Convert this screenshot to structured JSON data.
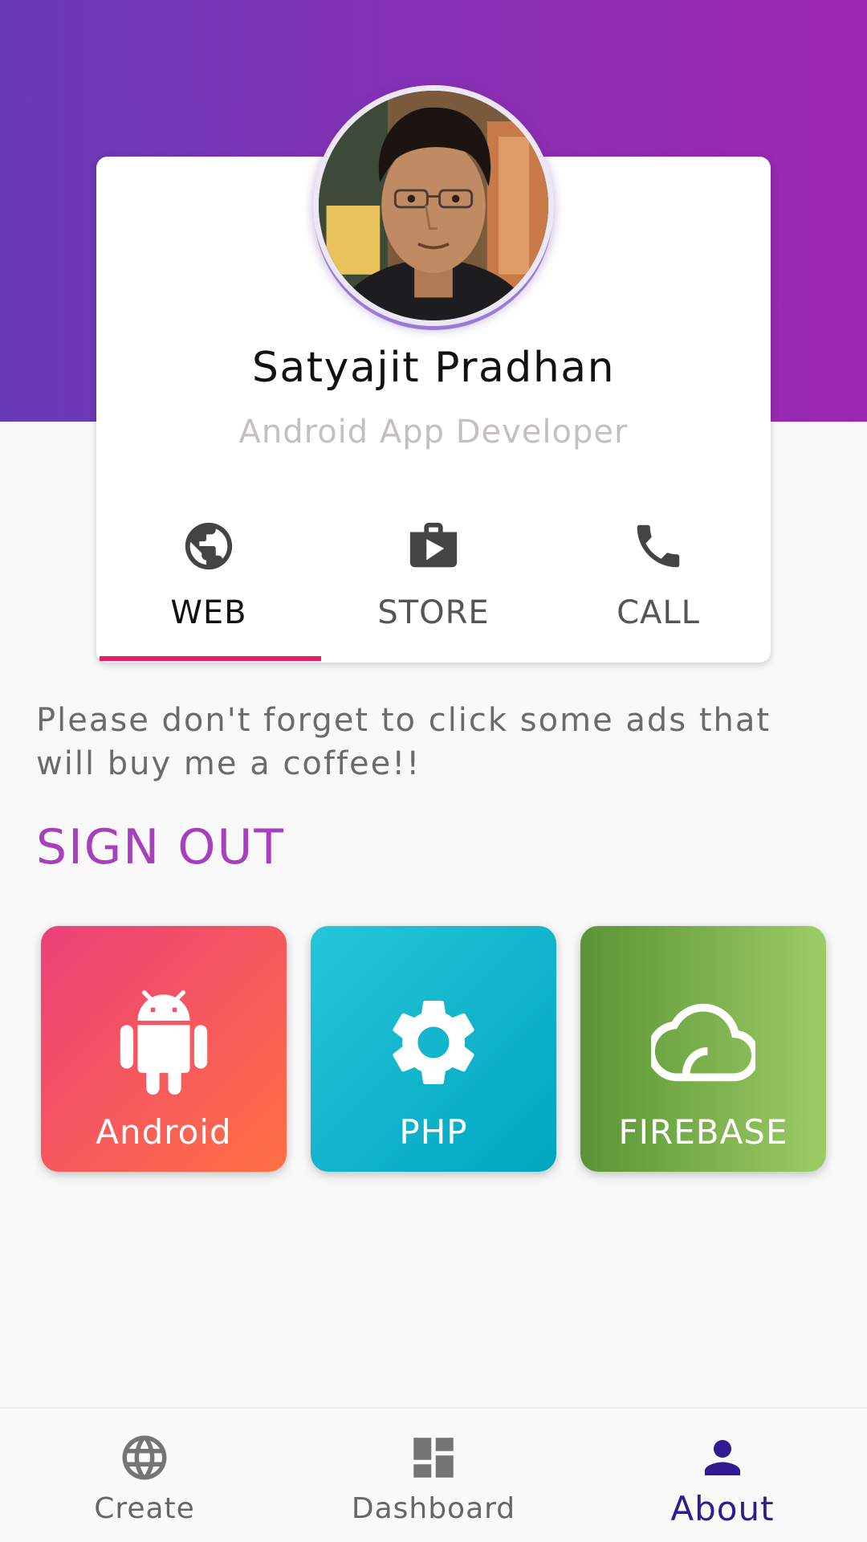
{
  "profile": {
    "name": "Satyajit Pradhan",
    "role": "Android App Developer",
    "avatar": "profile-photo"
  },
  "tabs": [
    {
      "label": "WEB",
      "icon": "globe-icon",
      "active": true
    },
    {
      "label": "STORE",
      "icon": "shop-icon",
      "active": false
    },
    {
      "label": "CALL",
      "icon": "phone-icon",
      "active": false
    }
  ],
  "message": "Please don't forget to click some ads that will buy me a coffee!!",
  "sign_out_label": "SIGN OUT",
  "tiles": [
    {
      "label": "Android",
      "icon": "android-icon"
    },
    {
      "label": "PHP",
      "icon": "gear-icon"
    },
    {
      "label": "FIREBASE",
      "icon": "cloud-icon"
    }
  ],
  "bottom_nav": [
    {
      "label": "Create",
      "icon": "globe-icon",
      "active": false
    },
    {
      "label": "Dashboard",
      "icon": "dashboard-icon",
      "active": false
    },
    {
      "label": "About",
      "icon": "person-icon",
      "active": true
    }
  ],
  "colors": {
    "header_gradient_start": "#673ab7",
    "header_gradient_end": "#9c27b0",
    "tab_indicator": "#e91e63",
    "sign_out": "#a83fbf",
    "active_nav": "#311b92"
  }
}
